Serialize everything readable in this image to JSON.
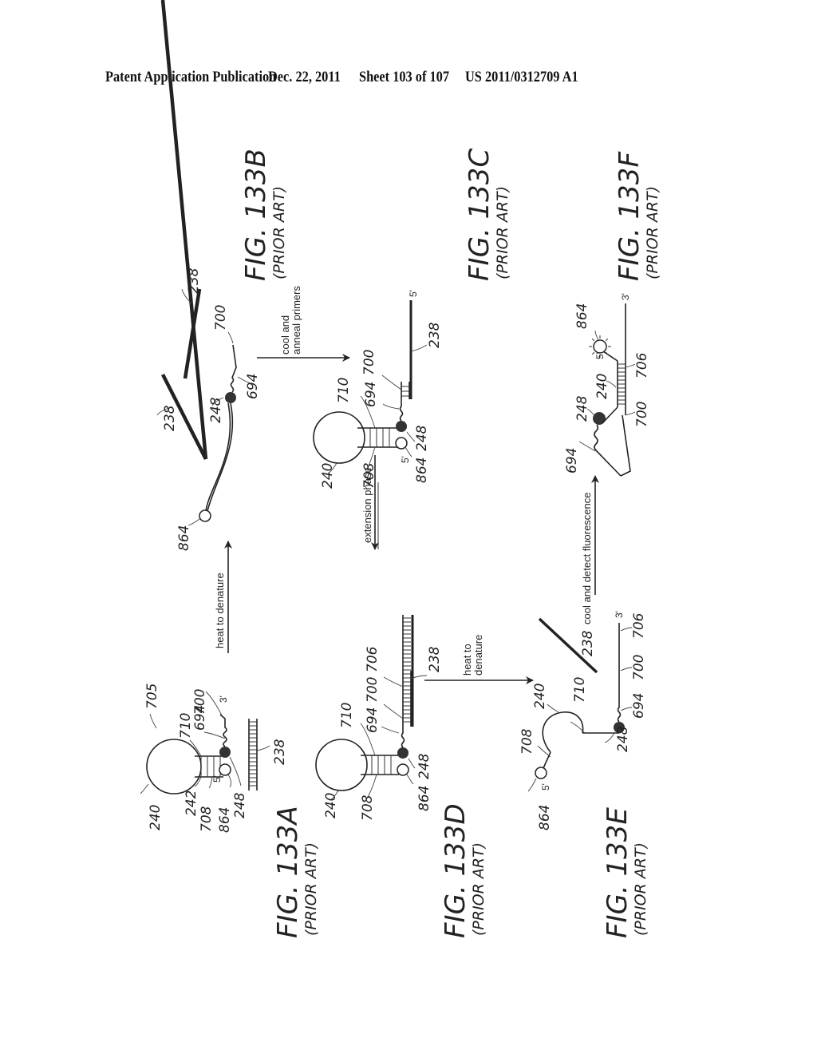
{
  "header": {
    "publication": "Patent Application Publication",
    "date": "Dec. 22, 2011",
    "sheet": "Sheet 103 of 107",
    "number": "US 2011/0312709 A1"
  },
  "figures": {
    "a": {
      "label": "FIG. 133A",
      "sub": "(PRIOR ART)"
    },
    "b": {
      "label": "FIG. 133B",
      "sub": "(PRIOR ART)"
    },
    "c": {
      "label": "FIG. 133C",
      "sub": "(PRIOR ART)"
    },
    "d": {
      "label": "FIG. 133D",
      "sub": "(PRIOR ART)"
    },
    "e": {
      "label": "FIG. 133E",
      "sub": "(PRIOR ART)"
    },
    "f": {
      "label": "FIG. 133F",
      "sub": "(PRIOR ART)"
    }
  },
  "steps": {
    "a_to_b": "heat to denature",
    "b_to_c_1": "cool and",
    "b_to_c_2": "anneal primers",
    "c_to_d": "extension phase",
    "d_to_e_1": "heat to",
    "d_to_e_2": "denature",
    "e_to_f": "cool and detect fluorescence"
  },
  "refs": {
    "r705": "705",
    "r240": "240",
    "r242": "242",
    "r708": "708",
    "r864": "864",
    "r248": "248",
    "r710": "710",
    "r694": "694",
    "r700": "700",
    "r706": "706",
    "r238": "238"
  },
  "primes": {
    "five": "5'",
    "three": "3'"
  }
}
